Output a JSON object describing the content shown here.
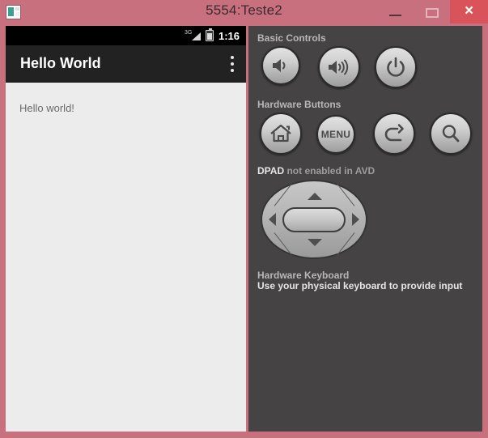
{
  "window": {
    "title": "5554:Teste2",
    "app_icon": "emulator-window-icon",
    "controls": {
      "minimize": "minimize-button",
      "maximize": "maximize-button",
      "close_label": "×"
    },
    "colors": {
      "titlebar": "#c9707f",
      "close_button": "#d9535b",
      "panel_background": "#454343",
      "phone_content": "#ececec",
      "action_bar": "#222222"
    }
  },
  "emulator": {
    "status_bar": {
      "network_label": "3G",
      "signal_icon": "signal-bars-icon",
      "battery_icon": "battery-icon",
      "time": "1:16"
    },
    "action_bar": {
      "title": "Hello World",
      "overflow_icon": "overflow-menu-icon"
    },
    "content": {
      "text": "Hello world!"
    }
  },
  "panel": {
    "sections": {
      "basic": {
        "label": "Basic Controls",
        "buttons": [
          {
            "name": "volume-down-button",
            "icon": "speaker-low-icon",
            "label": ""
          },
          {
            "name": "volume-up-button",
            "icon": "speaker-high-icon",
            "label": ""
          },
          {
            "name": "power-button",
            "icon": "power-icon",
            "label": ""
          }
        ]
      },
      "hardware": {
        "label": "Hardware Buttons",
        "buttons": [
          {
            "name": "home-button",
            "icon": "home-icon",
            "label": ""
          },
          {
            "name": "menu-button",
            "icon": "menu-text-icon",
            "label": "MENU"
          },
          {
            "name": "back-button",
            "icon": "back-arrow-icon",
            "label": ""
          },
          {
            "name": "search-button",
            "icon": "search-icon",
            "label": ""
          }
        ]
      },
      "dpad": {
        "label_strong": "DPAD",
        "label_dim": "not enabled in AVD",
        "buttons": [
          {
            "name": "dpad-up-button",
            "icon": "triangle-up-icon"
          },
          {
            "name": "dpad-down-button",
            "icon": "triangle-down-icon"
          },
          {
            "name": "dpad-left-button",
            "icon": "triangle-left-icon"
          },
          {
            "name": "dpad-right-button",
            "icon": "triangle-right-icon"
          },
          {
            "name": "dpad-select-button",
            "icon": "oval-select-icon"
          }
        ]
      },
      "keyboard": {
        "label": "Hardware Keyboard",
        "hint": "Use your physical keyboard to provide input"
      }
    }
  }
}
